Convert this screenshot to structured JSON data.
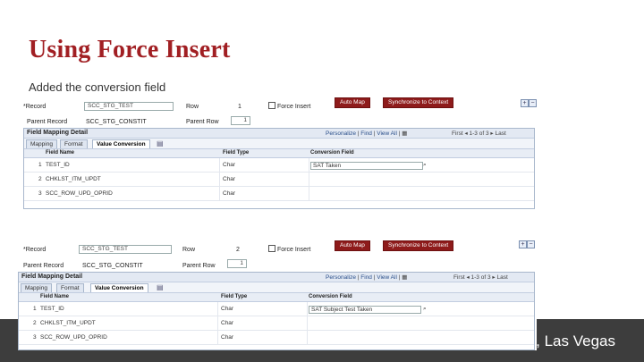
{
  "slide": {
    "title": "Using Force Insert",
    "subtitle": "Added the conversion field",
    "footer_text": ", Las Vegas"
  },
  "screens": [
    {
      "record_label": "*Record",
      "record_value": "SCC_STG_TEST",
      "row_label": "Row",
      "row_value": "1",
      "force_insert_label": "Force Insert",
      "parent_record_label": "Parent Record",
      "parent_record_value": "SCC_STG_CONSTIT",
      "parent_row_label": "Parent Row",
      "parent_row_value": "1",
      "auto_map_label": "Auto Map",
      "sync_label": "Synchronize to Context",
      "grid_title": "Field Mapping Detail",
      "personalize": "Personalize",
      "find": "Find",
      "view_all": "View All",
      "first": "First",
      "range": "1-3 of 3",
      "last": "Last",
      "tabs": [
        "Mapping",
        "Format",
        "Value Conversion"
      ],
      "columns": [
        "Field Name",
        "Field Type",
        "Conversion Field"
      ],
      "rows": [
        {
          "num": "1",
          "name": "TEST_ID",
          "type": "Char",
          "conv": "SAT Taken"
        },
        {
          "num": "2",
          "name": "CHKLST_ITM_UPDT",
          "type": "Char",
          "conv": ""
        },
        {
          "num": "3",
          "name": "SCC_ROW_UPD_OPRID",
          "type": "Char",
          "conv": ""
        }
      ]
    },
    {
      "record_label": "*Record",
      "record_value": "SCC_STG_TEST",
      "row_label": "Row",
      "row_value": "2",
      "force_insert_label": "Force Insert",
      "parent_record_label": "Parent Record",
      "parent_record_value": "SCC_STG_CONSTIT",
      "parent_row_label": "Parent Row",
      "parent_row_value": "1",
      "auto_map_label": "Auto Map",
      "sync_label": "Synchronize to Context",
      "grid_title": "Field Mapping Detail",
      "personalize": "Personalize",
      "find": "Find",
      "view_all": "View All",
      "first": "First",
      "range": "1-3 of 3",
      "last": "Last",
      "tabs": [
        "Mapping",
        "Format",
        "Value Conversion"
      ],
      "columns": [
        "Field Name",
        "Field Type",
        "Conversion Field"
      ],
      "rows": [
        {
          "num": "1",
          "name": "TEST_ID",
          "type": "Char",
          "conv": "SAT Subject Test Taken"
        },
        {
          "num": "2",
          "name": "CHKLST_ITM_UPDT",
          "type": "Char",
          "conv": ""
        },
        {
          "num": "3",
          "name": "SCC_ROW_UPD_OPRID",
          "type": "Char",
          "conv": ""
        }
      ]
    }
  ]
}
